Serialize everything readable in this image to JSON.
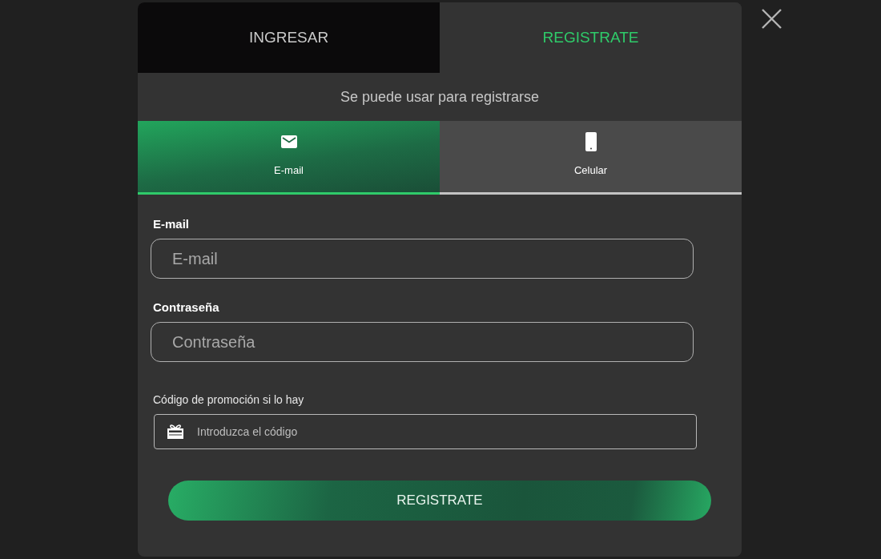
{
  "auth_tabs": [
    {
      "label": "INGRESAR",
      "selected": false
    },
    {
      "label": "REGISTRATE",
      "selected": true
    }
  ],
  "hint": "Se puede usar para registrarse",
  "methods": [
    {
      "label": "E-mail",
      "kind": "email",
      "selected": true
    },
    {
      "label": "Celular",
      "kind": "phone",
      "selected": false
    }
  ],
  "fields": [
    {
      "label": "E-mail",
      "placeholder": "E-mail"
    },
    {
      "label": "Contraseña",
      "placeholder": "Contraseña"
    }
  ],
  "promo": {
    "label": "Código de promoción si lo hay",
    "placeholder": "Introduzca el código"
  },
  "submit": "REGISTRATE"
}
